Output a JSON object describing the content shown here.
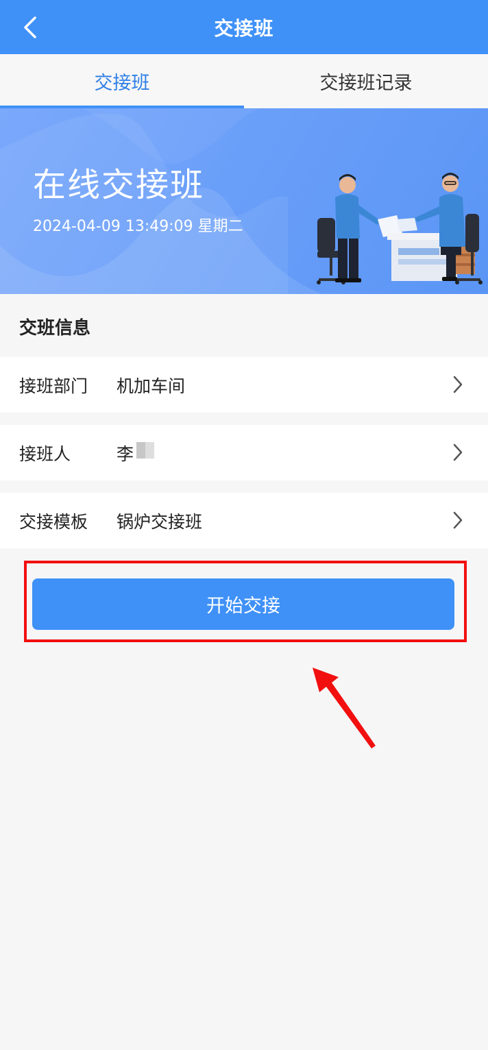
{
  "navbar": {
    "title": "交接班"
  },
  "tabs": [
    {
      "label": "交接班",
      "active": true
    },
    {
      "label": "交接班记录",
      "active": false
    }
  ],
  "banner": {
    "title": "在线交接班",
    "datetime": "2024-04-09 13:49:09 星期二"
  },
  "section": {
    "title": "交班信息"
  },
  "rows": [
    {
      "label": "接班部门",
      "value": "机加车间"
    },
    {
      "label": "接班人",
      "value": "李"
    },
    {
      "label": "交接模板",
      "value": "锅炉交接班"
    }
  ],
  "actions": {
    "start_label": "开始交接"
  },
  "colors": {
    "primary": "#3f91f7",
    "active_tab": "#2f7fe6",
    "highlight": "#f20f0f",
    "background": "#f6f6f7"
  },
  "icons": [
    "back-arrow-icon",
    "chevron-right-icon",
    "annotation-arrow-icon"
  ]
}
